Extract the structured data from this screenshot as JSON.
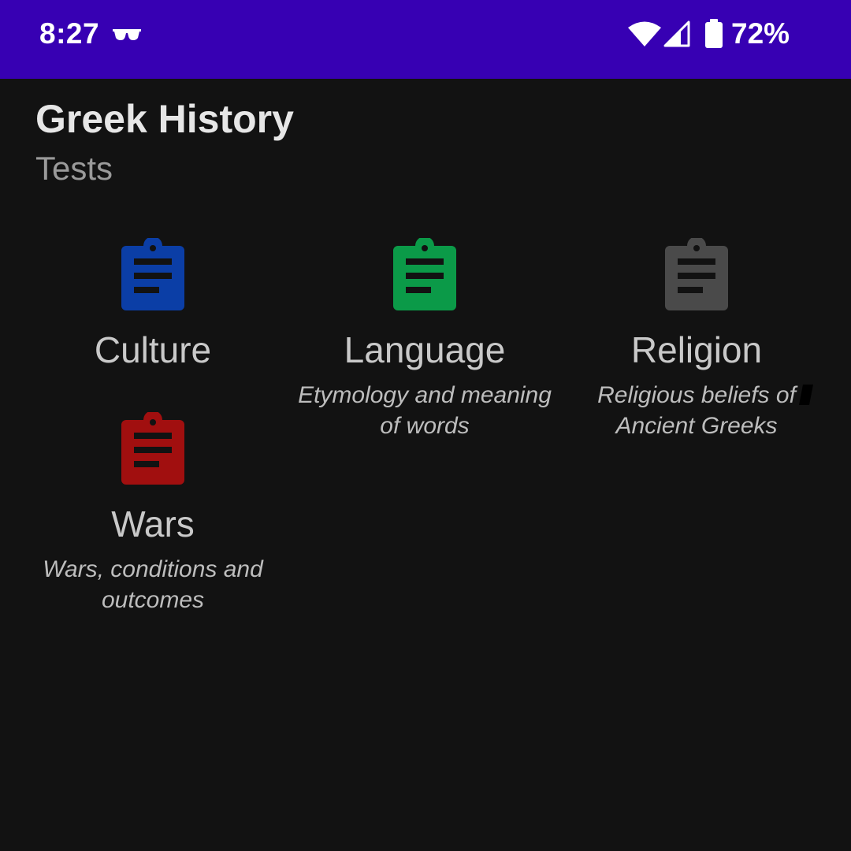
{
  "status_bar": {
    "time": "8:27",
    "battery_percent": "72%",
    "icons": [
      "glasses-icon",
      "wifi-icon",
      "cell-signal-icon",
      "battery-icon"
    ],
    "background_color": "#3700b3"
  },
  "header": {
    "title": "Greek History",
    "subtitle": "Tests"
  },
  "tests": [
    {
      "title": "Culture",
      "description": "",
      "icon": "clipboard-icon",
      "color": "#0b3ea6"
    },
    {
      "title": "Language",
      "description": "Etymology and meaning of words",
      "icon": "clipboard-icon",
      "color": "#0b9a48"
    },
    {
      "title": "Religion",
      "description": "Religious beliefs of Ancient Greeks",
      "icon": "clipboard-icon",
      "color": "#4a4a4a"
    },
    {
      "title": "Wars",
      "description": "Wars, conditions and outcomes",
      "icon": "clipboard-icon",
      "color": "#a10f0f"
    }
  ]
}
